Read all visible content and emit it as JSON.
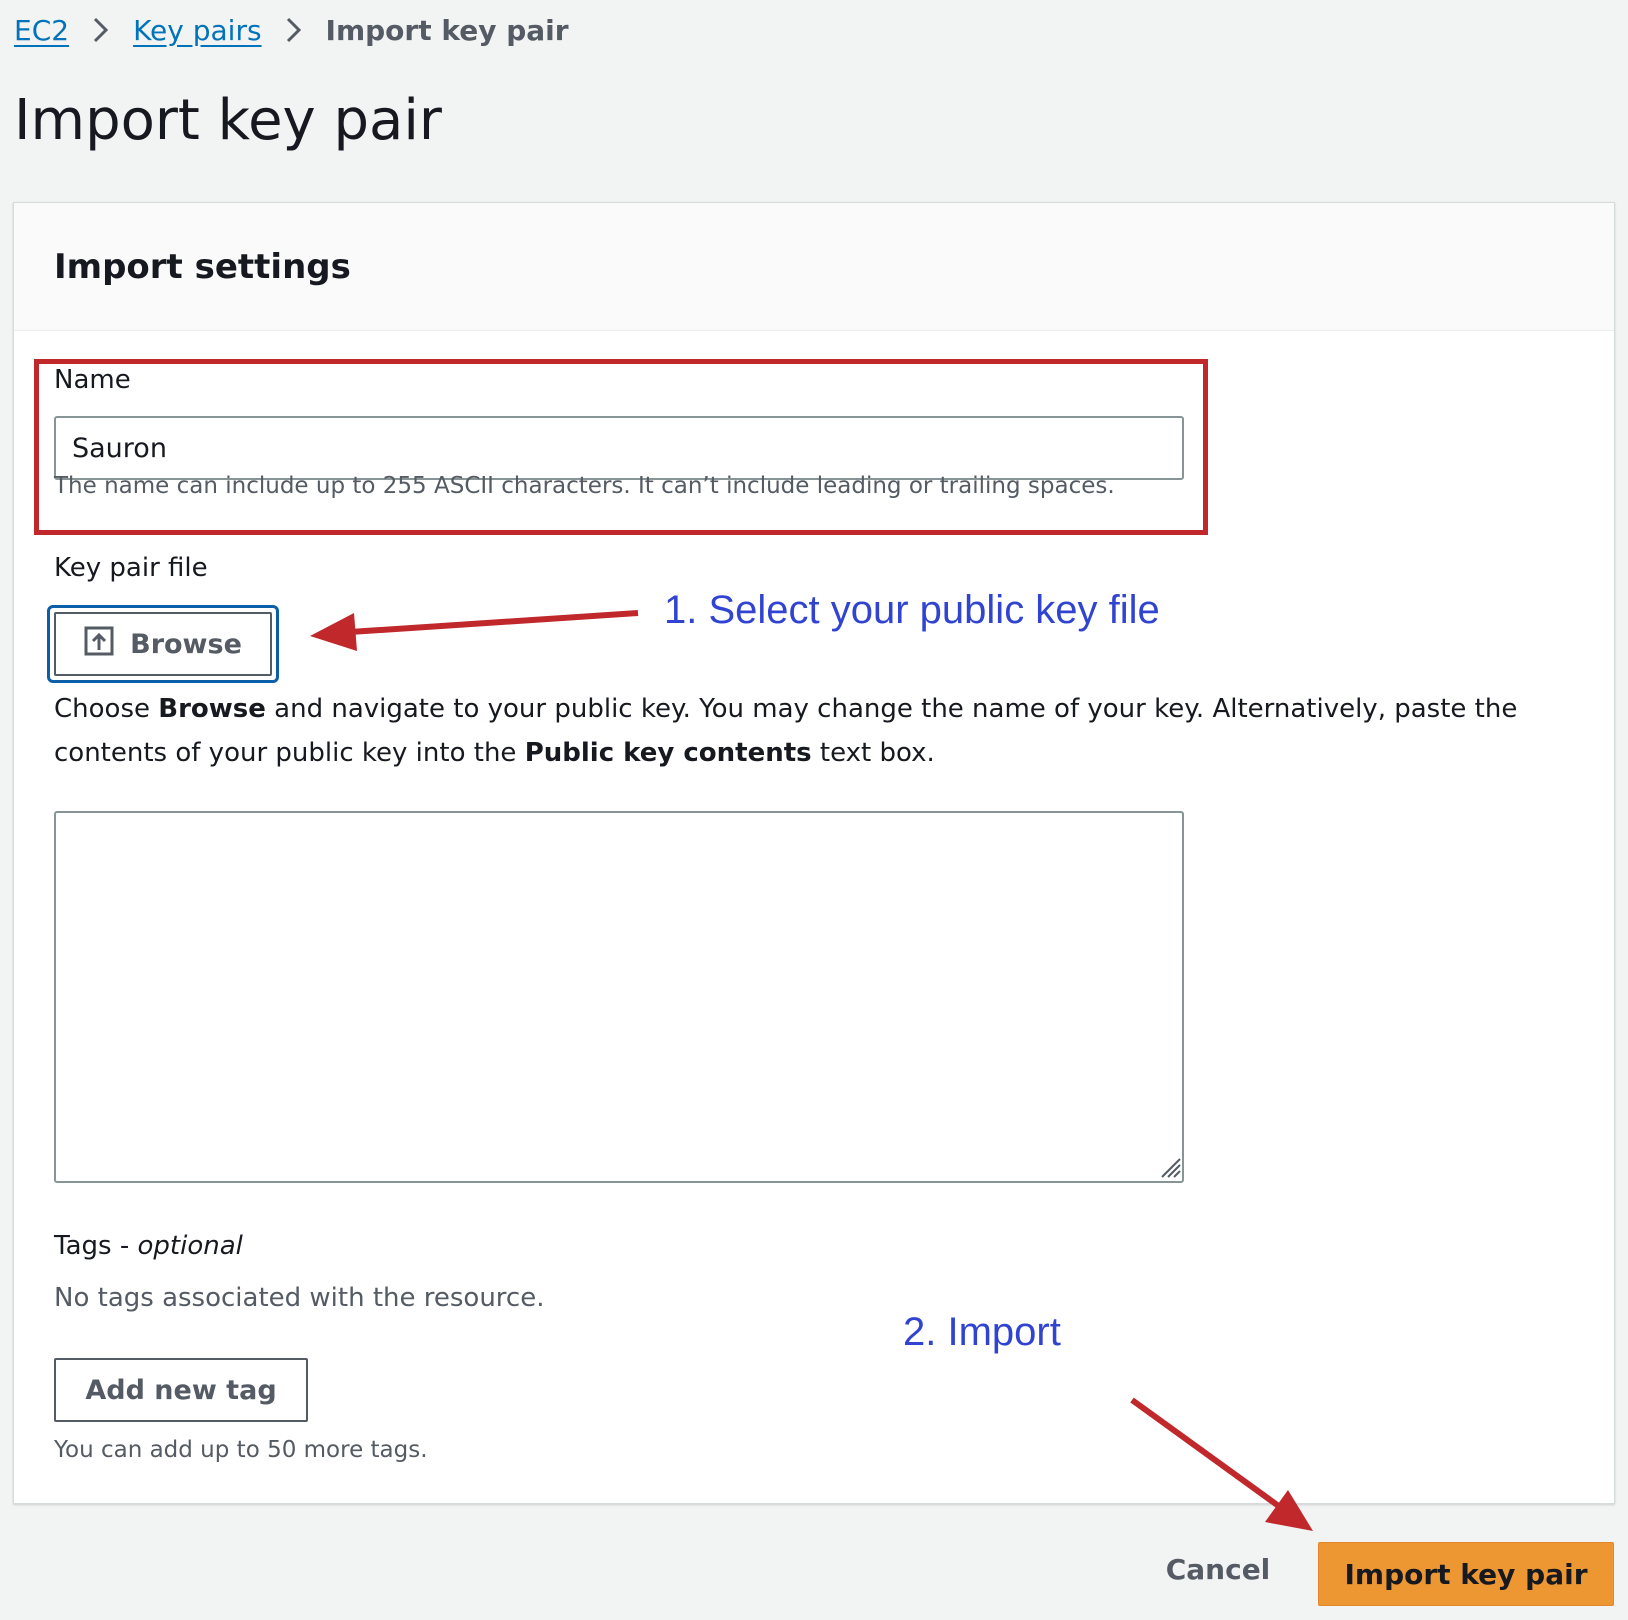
{
  "breadcrumb": {
    "items": [
      {
        "label": "EC2"
      },
      {
        "label": "Key pairs"
      },
      {
        "label": "Import key pair"
      }
    ]
  },
  "page": {
    "title": "Import key pair"
  },
  "panel": {
    "title": "Import settings",
    "name_field": {
      "label": "Name",
      "value": "Sauron",
      "hint": "The name can include up to 255 ASCII characters. It can’t include leading or trailing spaces."
    },
    "key_pair_file": {
      "label": "Key pair file",
      "browse_label": "Browse",
      "description": {
        "part1": "Choose ",
        "bold1": "Browse",
        "part2": " and navigate to your public key. You may change the name of your key. Alternatively, paste the contents of your public key into the ",
        "bold2": "Public key contents",
        "part3": " text box."
      },
      "textarea_value": ""
    },
    "tags": {
      "label": "Tags - ",
      "label_optional": "optional",
      "empty_text": "No tags associated with the resource.",
      "add_button": "Add new tag",
      "hint": "You can add up to 50 more tags."
    }
  },
  "footer": {
    "cancel_label": "Cancel",
    "import_label": "Import key pair"
  },
  "annotations": {
    "step1": "1. Select your public key file",
    "step2": "2. Import"
  },
  "icons": {
    "separator": "chevron-right-icon",
    "browse": "upload-icon",
    "resize": "resize-grip-icon"
  },
  "colors": {
    "link": "#0073bb",
    "primary_button": "#ec9731",
    "highlight": "#c0282b",
    "annotation_text": "#3044d1",
    "annotation_arrow": "#c0282b",
    "focus_ring": "#0a5fa8"
  }
}
